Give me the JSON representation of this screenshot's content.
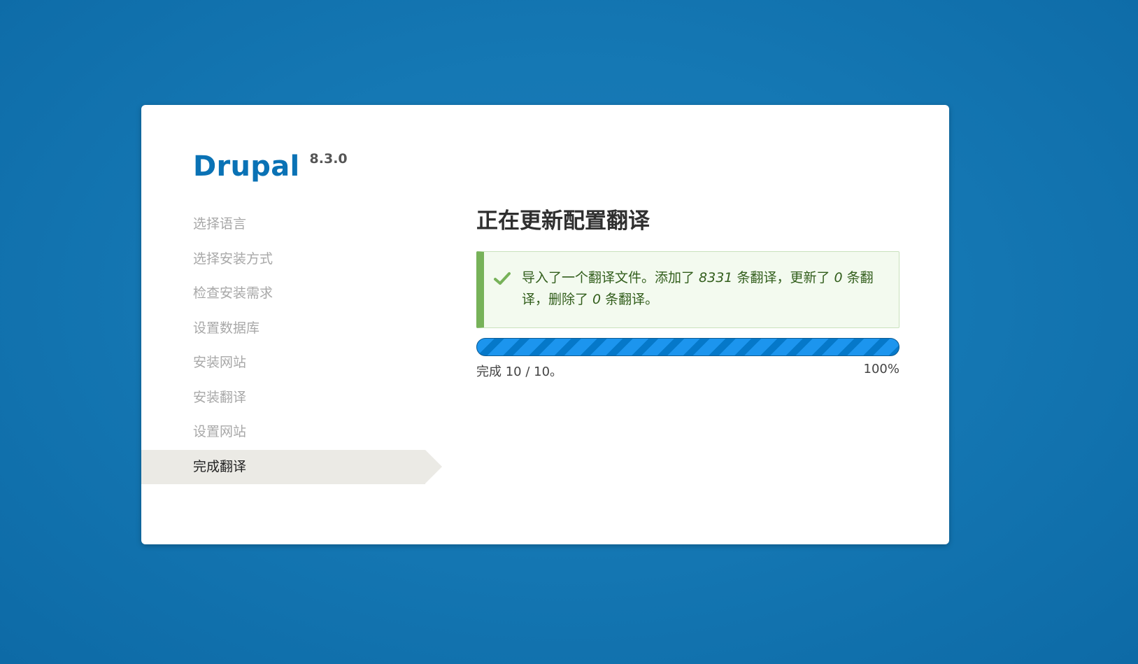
{
  "brand": {
    "name": "Drupal",
    "version": "8.3.0"
  },
  "steps": [
    {
      "label": "选择语言",
      "active": false
    },
    {
      "label": "选择安装方式",
      "active": false
    },
    {
      "label": "检查安装需求",
      "active": false
    },
    {
      "label": "设置数据库",
      "active": false
    },
    {
      "label": "安装网站",
      "active": false
    },
    {
      "label": "安装翻译",
      "active": false
    },
    {
      "label": "设置网站",
      "active": false
    },
    {
      "label": "完成翻译",
      "active": true
    }
  ],
  "main": {
    "title": "正在更新配置翻译",
    "message": {
      "part1": "导入了一个翻译文件。添加了 ",
      "added": "8331",
      "part2": " 条翻译，更新了 ",
      "updated": "0",
      "part3": " 条翻译，删除了 ",
      "deleted": "0",
      "part4": " 条翻译。",
      "icon": "check-icon",
      "color": "#325e1c"
    },
    "progress": {
      "percent_value": 100,
      "status": "完成 10 / 10。",
      "percent_label": "100%"
    }
  },
  "colors": {
    "background": "#1578b4",
    "brand": "#0a72b5",
    "success_border": "#77b259",
    "progress": "#0b8ae6"
  }
}
